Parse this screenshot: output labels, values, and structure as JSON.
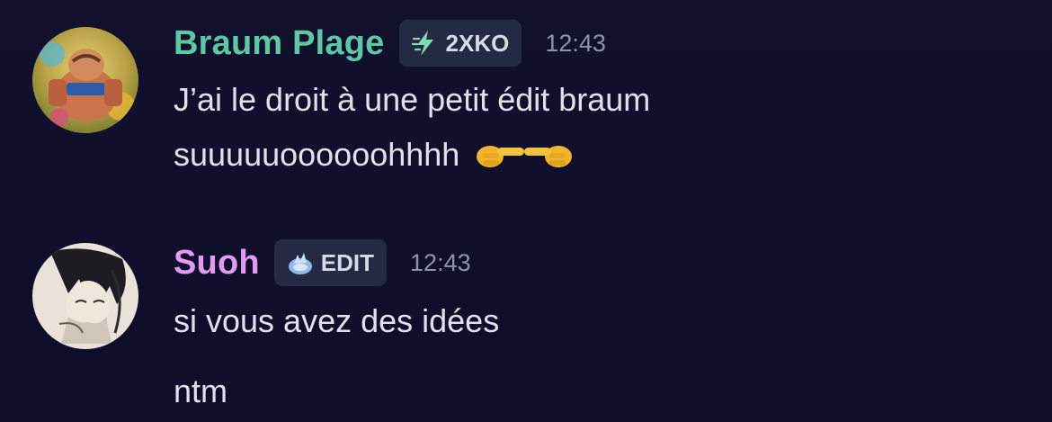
{
  "messages": [
    {
      "username": "Braum Plage",
      "username_color": "#5ec8a2",
      "tag": {
        "icon": "lightning-icon",
        "label": "2XKO"
      },
      "time": "12:43",
      "lines": [
        "J’ai le droit à une petit édit braum",
        "suuuuuoooooohhhh"
      ],
      "emoji": "pointing-hands-emoji"
    },
    {
      "username": "Suoh",
      "username_color": "#e19cf1",
      "tag": {
        "icon": "snow-crystal-icon",
        "label": "EDIT"
      },
      "time": "12:43",
      "lines": [
        "si vous avez des idées",
        "ntm"
      ]
    }
  ]
}
